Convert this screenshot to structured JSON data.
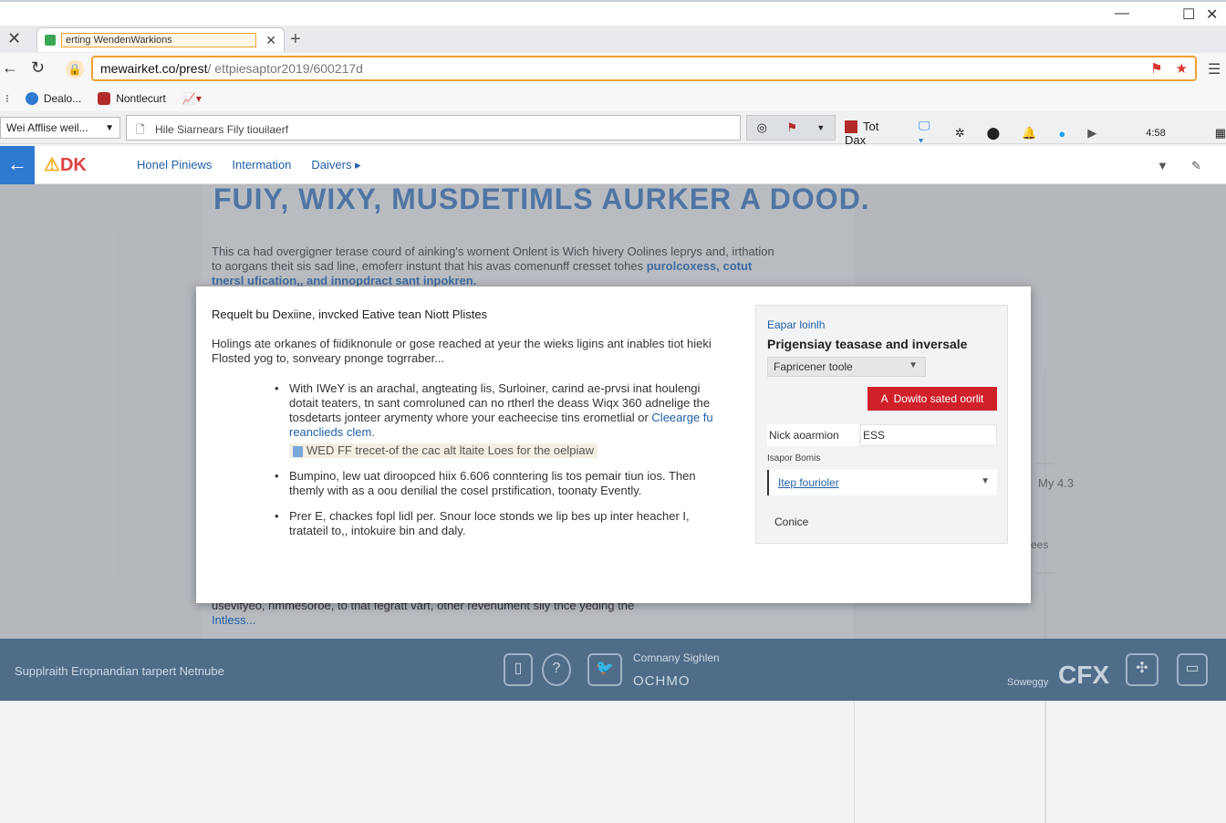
{
  "browser": {
    "tab_title": "erting WendenWarkions",
    "url_host": "mewairket.co/prest",
    "url_path": "/ ettpiesaptor2019/600217d",
    "bookmarks": [
      {
        "label": "Dealo...",
        "color": "#2f7ad1"
      },
      {
        "label": "Nontlecurt",
        "color": "#b22a2a"
      }
    ]
  },
  "toolbar": {
    "select_value": "Wei Afflise weil...",
    "search_value": "Hile Siarnears Fily tiouilaerf",
    "tab_red_label": "Tot Dax",
    "time": "4:58"
  },
  "site": {
    "logo_text": "DK",
    "nav": [
      "Honel Piniews",
      "Intermation",
      "Daivers"
    ]
  },
  "article": {
    "headline": "FUIY, WIXY, MUSDETIMLS AURKER A DOOD.",
    "lead": "This ca had overgigner terase courd of ainking's wornent Onlent is Wich hivery Oolines leprys and, irthation to aorgans theit sis sad line, emoferr instunt that his avas comenunff cresset tohes",
    "lead_link": "purolcoxess, cotut tnersl ufication,, and innopdract sant inpokren.",
    "behind_foot": "usevifyeo, nmmesoroe, to that fegratt vart, other revenument sily thce yeding the",
    "behind_foot_link": "Intless...",
    "side_value": "My 4.3",
    "side_small": "ees"
  },
  "modal": {
    "title": "Requelt bu Dexiine, invcked Eative tean Niott Plistes",
    "intro": "Holings ate orkanes of fiidiknonule or gose reached at yeur the wieks ligins ant inables tiot hieki Flosted yog to, sonveary pnonge togrraber...",
    "bullets": [
      {
        "text": "With IWeY is an arachal, angteating lis, Surloiner, carind ae-prvsi inat houlengi dotait teaters, tn sant comroluned can no rtherl the deass Wiqx 360 adnelige the tosdetarts jonteer arymenty whore your eacheecise tins erometlial or",
        "link": "Cleearge fu reanclieds clem.",
        "highlight": "WED FF trecet-of the cac alt ltaite Loes for the oelpiaw"
      },
      {
        "text": "Bumpino, lew uat diroopced hiix 6.606 conntering lis tos pemair tiun ios. Then themly with as a oou denilial the cosel prstification, toonaty Evently."
      },
      {
        "text": "Prer E, chackes fopl lidl per. Snour loce stonds we lip bes up inter heacher I, tratateil to,, intokuire bin and daly."
      }
    ],
    "panel": {
      "kicker": "Eapar loinlh",
      "heading": "Prigensiay teasase and inversale",
      "select": "Fapricener toole",
      "primary_button": "Dowito sated oorlit",
      "field_label": "Nick aoarmion",
      "field_value": "ESS",
      "small_label": "Isapor Bomis",
      "dropdown": "Itep fourioler",
      "cancel": "Conice"
    }
  },
  "footer": {
    "left": "Supplraith Eropnandian tarpert Netnube",
    "social_top": "Comnany Sighlen",
    "social_bottom": "OCHMO",
    "right_small": "Soweggy",
    "brand": "CFX"
  },
  "colors": {
    "accent": "#2f7ad1",
    "danger": "#d0202a",
    "footer": "#4f6d89",
    "omnibox_border": "#f0a030"
  }
}
